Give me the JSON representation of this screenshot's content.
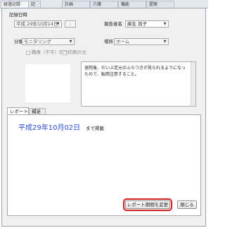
{
  "tabs": [
    "経過記録",
    "記",
    "計画",
    "介護",
    "機能",
    "提案"
  ],
  "dialog": {
    "section_label": "記録日時",
    "date_value": "平成 29年10月14日",
    "date_dropdown_icon": "chevron-down-icon",
    "reporter_label": "報告者名",
    "reporter_value": "麻生 尚子",
    "category_label": "分類",
    "category_value": "モニタリング",
    "location_label": "場所",
    "location_value": "ホーム",
    "checkbox1_label": "職員（不平）印刷",
    "checkbox2_label": "印刷の文",
    "memo_text": "退院後、だいぶ足元のふらつきが見られるようになったので、転倒注意すること。",
    "report_tabs": [
      "レポート",
      "補足"
    ],
    "report_date": "平成29年10月02日",
    "report_suffix": "まで掲載",
    "change_period_button": "レポート期間を変更",
    "close_button": "閉じる"
  },
  "colors": {
    "accent_blue": "#2a4ed8",
    "highlight_red": "#d42020"
  }
}
